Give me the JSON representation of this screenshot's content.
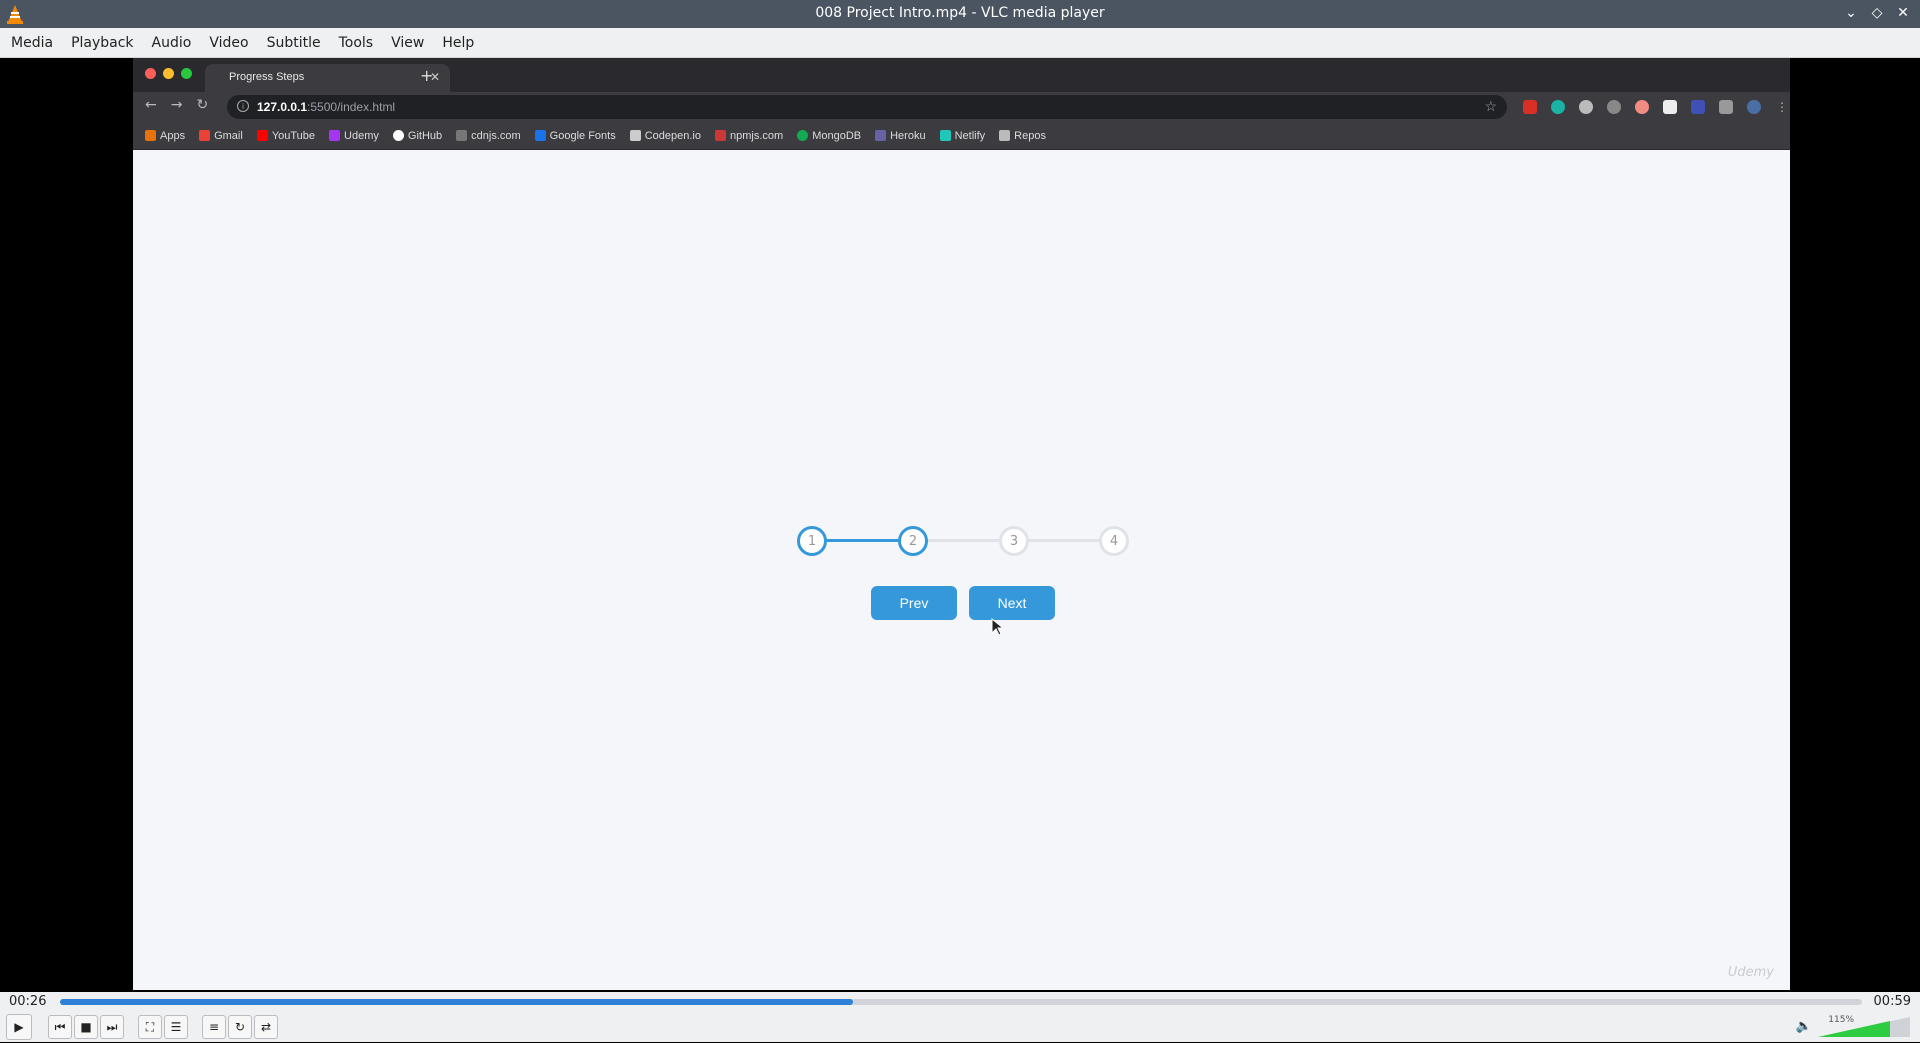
{
  "window": {
    "title": "008 Project Intro.mp4 - VLC media player"
  },
  "menu": [
    "Media",
    "Playback",
    "Audio",
    "Video",
    "Subtitle",
    "Tools",
    "View",
    "Help"
  ],
  "browser": {
    "tab_title": "Progress Steps",
    "url_host": "127.0.0.1",
    "url_rest": ":5500/index.html",
    "bookmarks": [
      "Apps",
      "Gmail",
      "YouTube",
      "Udemy",
      "GitHub",
      "cdnjs.com",
      "Google Fonts",
      "Codepen.io",
      "npmjs.com",
      "MongoDB",
      "Heroku",
      "Netlify",
      "Repos"
    ]
  },
  "page": {
    "steps": [
      "1",
      "2",
      "3",
      "4"
    ],
    "active_steps": 2,
    "progress_fraction": 0.333,
    "prev_label": "Prev",
    "next_label": "Next",
    "watermark": "Udemy"
  },
  "player": {
    "elapsed": "00:26",
    "duration": "00:59",
    "progress_fraction": 0.44,
    "volume_label": "115%"
  },
  "colors": {
    "accent": "#3498db",
    "seek": "#2e7fd6"
  }
}
